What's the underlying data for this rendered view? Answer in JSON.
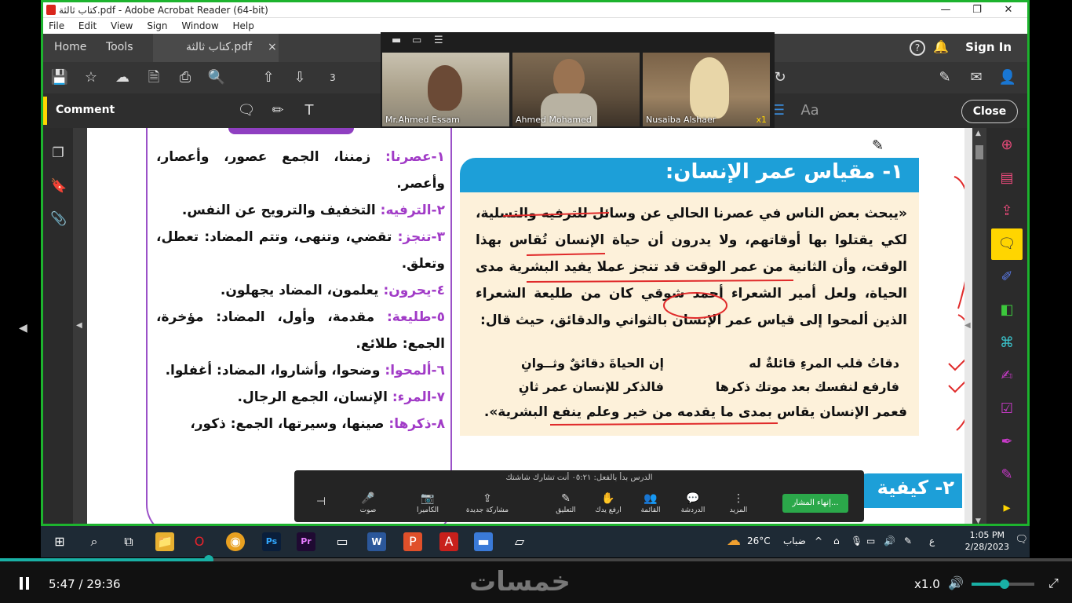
{
  "window": {
    "title": "كتاب ثالثة.pdf - Adobe Acrobat Reader (64-bit)",
    "minimize": "—",
    "restore": "❐",
    "close": "✕"
  },
  "menu": [
    "File",
    "Edit",
    "View",
    "Sign",
    "Window",
    "Help"
  ],
  "tabs": {
    "home": "Home",
    "tools": "Tools",
    "doc": "كتاب ثالثة.pdf",
    "close": "×"
  },
  "header": {
    "help": "?",
    "sign_in": "Sign In"
  },
  "toolbar": {
    "page_num": "3"
  },
  "comment_bar": {
    "label": "Comment",
    "text_tool": "T",
    "font_tool": "Aa",
    "close": "Close"
  },
  "zoom_videos": [
    {
      "name": "Mr.Ahmed Essam",
      "badge": ""
    },
    {
      "name": "Ahmed Mohamed",
      "badge": ""
    },
    {
      "name": "Nusaiba Alshaer",
      "badge": "x1"
    }
  ],
  "page": {
    "vocab": [
      {
        "kw": "١-عصرنا:",
        "text": " زمننا، الجمع عصور، وأعصار، وأعصر."
      },
      {
        "kw": "٢-الترفيه:",
        "text": " التخفيف والترويح عن النفس."
      },
      {
        "kw": "٣-تنجز:",
        "text": " تقضي، وتنهى، وتتم المضاد: تعطل، وتعلق."
      },
      {
        "kw": "٤-يحرون:",
        "text": " يعلمون، المضاد يجهلون."
      },
      {
        "kw": "٥-طليعة:",
        "text": " مقدمة، وأول، المضاد: مؤخرة، الجمع: طلائع."
      },
      {
        "kw": "٦-ألمحوا:",
        "text": " وضحوا، وأشاروا، المضاد: أغفلوا."
      },
      {
        "kw": "٧-المرء:",
        "text": " الإنسان، الجمع الرجال."
      },
      {
        "kw": "٨-ذكرها:",
        "text": " صينها، وسيرتها، الجمع: ذكور،"
      }
    ],
    "heading1": "١- مقياس عمر الإنسان:",
    "paragraph": "«يبحث بعض الناس في عصرنا الحالي عن وسائل للترفيه والتسلية، لكي يقتلوا بها أوقاتهم، ولا يدرون أن حياة الإنسان تُقاس بهذا الوقت، وأن الثانية من عمر الوقت قد تنجز عملا يفيد البشرية مدى الحياة، ولعل أمير الشعراء أحمد شوقي كان من طليعة الشعراء الذين ألمحوا إلى قياس عمر الإنسان بالثواني والدقائق، حيث قال:",
    "poem": [
      {
        "a": "دقاتُ قلب المرءِ قائلةٌ له",
        "b": "إن الحياةَ دقائقٌ وثــوانِ"
      },
      {
        "a": "فارفع لنفسك بعد موتك ذكرها",
        "b": "فالذكر للإنسان عمر ثانِ"
      }
    ],
    "closing": "فعمر الإنسان يقاس بمدى ما يقدمه من خير وعلم ينفع البشرية».",
    "heading2": "٢- كيفية"
  },
  "zoom_controls": {
    "status": "الدرس بدأ بالفعل: ٠٥:٢١   أنت تشارك شاشتك",
    "items": [
      "صوت",
      "الكاميرا",
      "مشاركة جديدة",
      "التعليق",
      "ارفع يدك",
      "القائمة",
      "الدردشة",
      "المزيد"
    ],
    "end": "إنهاء المشار..."
  },
  "taskbar": {
    "apps": [
      "Ps",
      "Pr",
      "W"
    ],
    "temp": "26°C",
    "weather": "ضباب",
    "lang": "ع",
    "time": "1:05 PM",
    "date": "2/28/2023",
    "notif": "3"
  },
  "player": {
    "current": "5:47",
    "separator": "/",
    "total": "29:36",
    "progress": 0.195,
    "logo": "خمسات",
    "speed": "x1.0",
    "volume": 0.52
  },
  "colors": {
    "share_border": "#1db32e",
    "accent_yellow": "#ffd500",
    "heading_blue": "#1d9fd8",
    "keyword_purple": "#a13bc7",
    "progress": "#19b0a5"
  }
}
